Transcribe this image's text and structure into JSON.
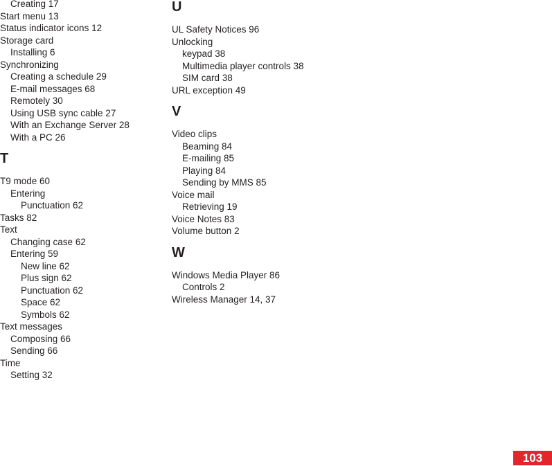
{
  "left_column": [
    {
      "type": "entry",
      "level": 1,
      "text": "Creating  17"
    },
    {
      "type": "entry",
      "level": 0,
      "text": "Start menu  13"
    },
    {
      "type": "entry",
      "level": 0,
      "text": "Status indicator icons  12"
    },
    {
      "type": "entry",
      "level": 0,
      "text": "Storage card"
    },
    {
      "type": "entry",
      "level": 1,
      "text": "Installing  6"
    },
    {
      "type": "entry",
      "level": 0,
      "text": "Synchronizing"
    },
    {
      "type": "entry",
      "level": 1,
      "text": "Creating a schedule  29"
    },
    {
      "type": "entry",
      "level": 1,
      "text": "E-mail messages  68"
    },
    {
      "type": "entry",
      "level": 1,
      "text": "Remotely  30"
    },
    {
      "type": "entry",
      "level": 1,
      "text": "Using USB sync cable  27"
    },
    {
      "type": "entry",
      "level": 1,
      "text": "With an Exchange Server  28"
    },
    {
      "type": "entry",
      "level": 1,
      "text": "With a PC  26"
    },
    {
      "type": "letter",
      "text": "T"
    },
    {
      "type": "entry",
      "level": 0,
      "text": "T9 mode  60"
    },
    {
      "type": "entry",
      "level": 1,
      "text": "Entering"
    },
    {
      "type": "entry",
      "level": 2,
      "text": "Punctuation  62"
    },
    {
      "type": "entry",
      "level": 0,
      "text": "Tasks  82"
    },
    {
      "type": "entry",
      "level": 0,
      "text": "Text"
    },
    {
      "type": "entry",
      "level": 1,
      "text": "Changing case  62"
    },
    {
      "type": "entry",
      "level": 1,
      "text": "Entering  59"
    },
    {
      "type": "entry",
      "level": 2,
      "text": "New line  62"
    },
    {
      "type": "entry",
      "level": 2,
      "text": "Plus sign  62"
    },
    {
      "type": "entry",
      "level": 2,
      "text": "Punctuation  62"
    },
    {
      "type": "entry",
      "level": 2,
      "text": "Space  62"
    },
    {
      "type": "entry",
      "level": 2,
      "text": "Symbols  62"
    },
    {
      "type": "entry",
      "level": 0,
      "text": "Text messages"
    },
    {
      "type": "entry",
      "level": 1,
      "text": "Composing  66"
    },
    {
      "type": "entry",
      "level": 1,
      "text": "Sending  66"
    },
    {
      "type": "entry",
      "level": 0,
      "text": "Time"
    },
    {
      "type": "entry",
      "level": 1,
      "text": "Setting  32"
    }
  ],
  "right_column": [
    {
      "type": "letter",
      "text": "U"
    },
    {
      "type": "entry",
      "level": 0,
      "text": "UL Safety Notices  96"
    },
    {
      "type": "entry",
      "level": 0,
      "text": "Unlocking"
    },
    {
      "type": "entry",
      "level": 1,
      "text": "keypad  38"
    },
    {
      "type": "entry",
      "level": 1,
      "text": "Multimedia player controls  38"
    },
    {
      "type": "entry",
      "level": 1,
      "text": "SIM card  38"
    },
    {
      "type": "entry",
      "level": 0,
      "text": "URL exception  49"
    },
    {
      "type": "letter",
      "text": "V"
    },
    {
      "type": "entry",
      "level": 0,
      "text": "Video clips"
    },
    {
      "type": "entry",
      "level": 1,
      "text": "Beaming  84"
    },
    {
      "type": "entry",
      "level": 1,
      "text": "E-mailing  85"
    },
    {
      "type": "entry",
      "level": 1,
      "text": "Playing  84"
    },
    {
      "type": "entry",
      "level": 1,
      "text": "Sending by MMS  85"
    },
    {
      "type": "entry",
      "level": 0,
      "text": "Voice mail"
    },
    {
      "type": "entry",
      "level": 1,
      "text": "Retrieving  19"
    },
    {
      "type": "entry",
      "level": 0,
      "text": "Voice Notes  83"
    },
    {
      "type": "entry",
      "level": 0,
      "text": "Volume button  2"
    },
    {
      "type": "letter",
      "text": "W"
    },
    {
      "type": "entry",
      "level": 0,
      "text": "Windows Media Player  86"
    },
    {
      "type": "entry",
      "level": 1,
      "text": "Controls  2"
    },
    {
      "type": "entry",
      "level": 0,
      "text": "Wireless Manager  14, 37"
    }
  ],
  "page_number": "103",
  "colors": {
    "page_badge": "#e3262b",
    "text": "#231f20"
  }
}
